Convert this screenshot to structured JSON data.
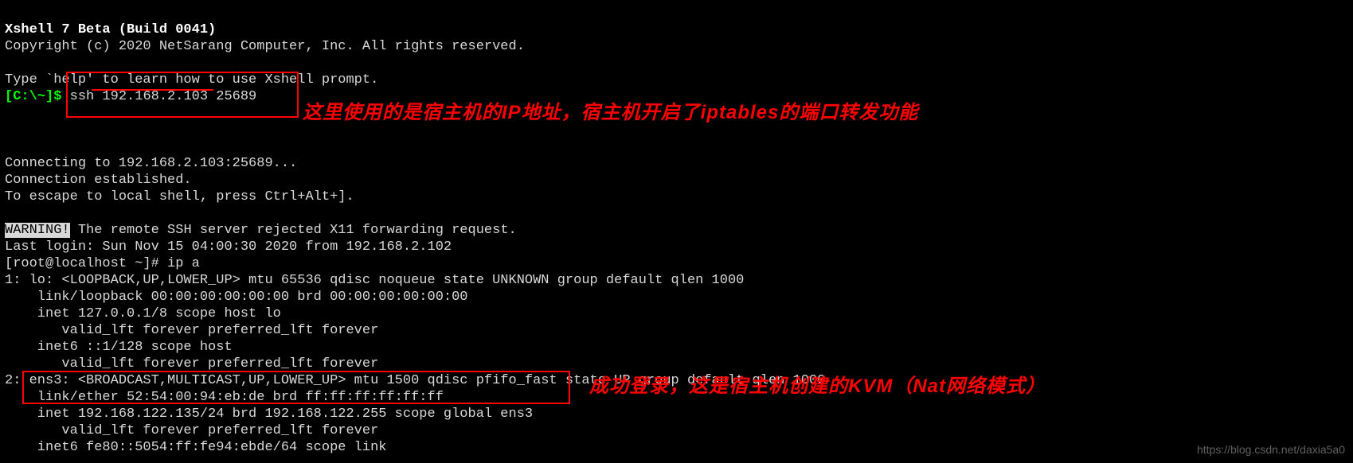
{
  "banner": {
    "title": "Xshell 7 Beta (Build 0041)",
    "copyright": "Copyright (c) 2020 NetSarang Computer, Inc. All rights reserved.",
    "help_hint": "Type `help' to learn how to use Xshell prompt."
  },
  "prompt": {
    "local_prefix": "[C:\\~]$ ",
    "ssh_command": "ssh 192.168.2.103 25689"
  },
  "connect": {
    "connecting": "Connecting to 192.168.2.103:25689...",
    "established": "Connection established.",
    "escape": "To escape to local shell, press Ctrl+Alt+]."
  },
  "warning": {
    "label": "WARNING!",
    "text": " The remote SSH server rejected X11 forwarding request."
  },
  "session": {
    "last_login": "Last login: Sun Nov 15 04:00:30 2020 from 192.168.2.102",
    "root_prompt": "[root@localhost ~]# ",
    "ip_cmd": "ip a"
  },
  "ip_output": {
    "l1": "1: lo: <LOOPBACK,UP,LOWER_UP> mtu 65536 qdisc noqueue state UNKNOWN group default qlen 1000",
    "l2": "    link/loopback 00:00:00:00:00:00 brd 00:00:00:00:00:00",
    "l3": "    inet 127.0.0.1/8 scope host lo",
    "l4": "       valid_lft forever preferred_lft forever",
    "l5": "    inet6 ::1/128 scope host ",
    "l6": "       valid_lft forever preferred_lft forever",
    "l7": "2: ens3: <BROADCAST,MULTICAST,UP,LOWER_UP> mtu 1500 qdisc pfifo_fast state UP group default qlen 1000",
    "l8": "    link/ether 52:54:00:94:eb:de brd ff:ff:ff:ff:ff:ff",
    "l9": "    inet 192.168.122.135/24 brd 192.168.122.255 scope global ens3",
    "l10": "       valid_lft forever preferred_lft forever",
    "l11": "    inet6 fe80::5054:ff:fe94:ebde/64 scope link "
  },
  "annot": {
    "a1": "这里使用的是宿主机的IP地址，宿主机开启了iptables的端口转发功能",
    "a2": "成功登录，这是宿主机创建的KVM（Nat网络模式）"
  },
  "watermark": "https://blog.csdn.net/daxia5a0"
}
